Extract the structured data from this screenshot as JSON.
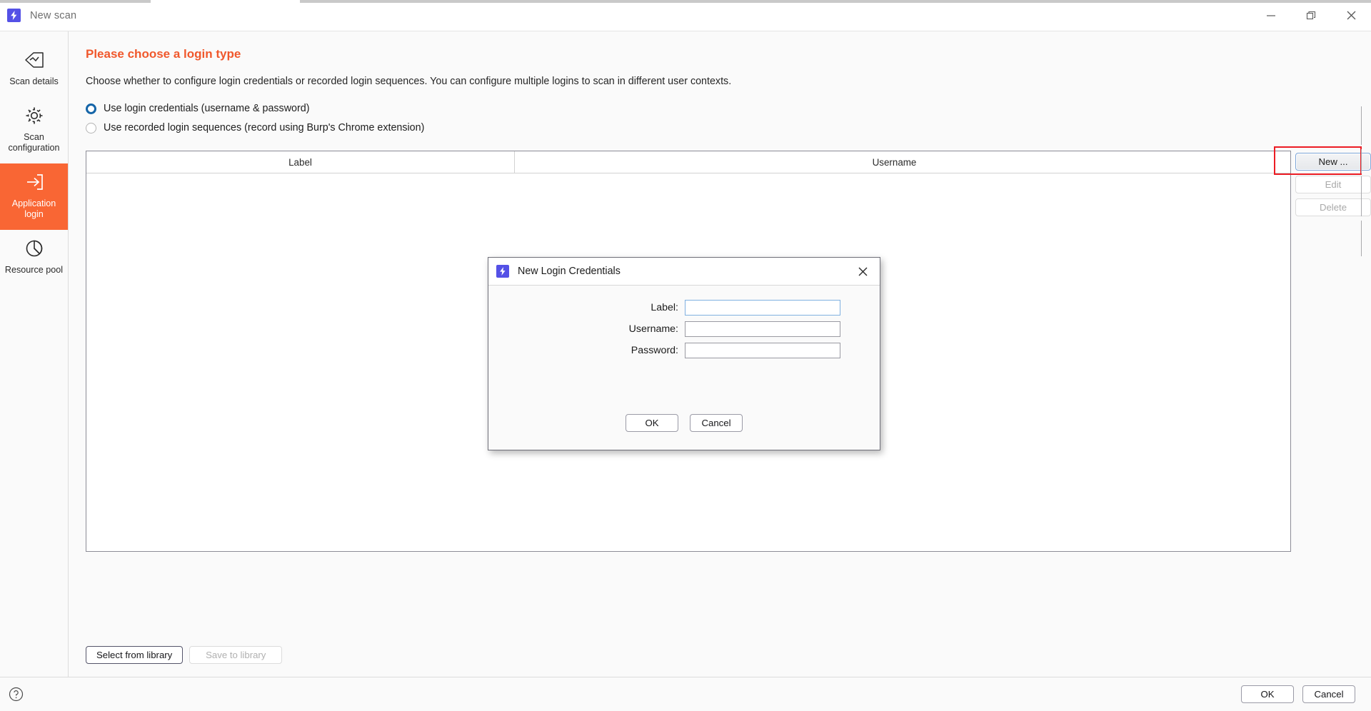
{
  "window": {
    "title": "New scan",
    "app_icon": "burp-lightning-icon",
    "controls": {
      "minimize": "minimize-icon",
      "restore": "restore-icon",
      "close": "close-icon"
    }
  },
  "sidebar": {
    "items": [
      {
        "label": "Scan details",
        "icon": "scan-details-icon",
        "active": false
      },
      {
        "label": "Scan configuration",
        "icon": "gear-icon",
        "active": false
      },
      {
        "label": "Application login",
        "icon": "login-arrow-icon",
        "active": true
      },
      {
        "label": "Resource pool",
        "icon": "pie-chart-icon",
        "active": false
      }
    ]
  },
  "main": {
    "title": "Please choose a login type",
    "description": "Choose whether to configure login credentials or recorded login sequences. You can configure multiple logins to scan in different user contexts.",
    "options": [
      {
        "label": "Use login credentials (username & password)",
        "checked": true
      },
      {
        "label": "Use recorded login sequences (record using Burp's Chrome extension)",
        "checked": false
      }
    ],
    "table": {
      "columns": [
        "Label",
        "Username"
      ],
      "rows": []
    },
    "side_buttons": [
      {
        "label": "New ...",
        "enabled": true,
        "highlighted": true
      },
      {
        "label": "Edit",
        "enabled": false,
        "highlighted": false
      },
      {
        "label": "Delete",
        "enabled": false,
        "highlighted": false
      }
    ],
    "library_buttons": [
      {
        "label": "Select from library",
        "enabled": true
      },
      {
        "label": "Save to library",
        "enabled": false
      }
    ]
  },
  "footer": {
    "help_icon": "help-circle-icon",
    "ok_label": "OK",
    "cancel_label": "Cancel"
  },
  "modal": {
    "title": "New Login Credentials",
    "icon": "burp-lightning-icon",
    "close_icon": "close-icon",
    "fields": [
      {
        "label": "Label:",
        "value": "",
        "placeholder": "",
        "focused": true
      },
      {
        "label": "Username:",
        "value": "",
        "placeholder": "",
        "focused": false
      },
      {
        "label": "Password:",
        "value": "",
        "placeholder": "",
        "focused": false
      }
    ],
    "ok_label": "OK",
    "cancel_label": "Cancel"
  },
  "colors": {
    "accent_orange": "#f96634",
    "title_orange": "#f0582c",
    "brand_purple": "#5451e6",
    "radio_blue": "#1565a8",
    "annotation_red": "#ec1c24"
  }
}
